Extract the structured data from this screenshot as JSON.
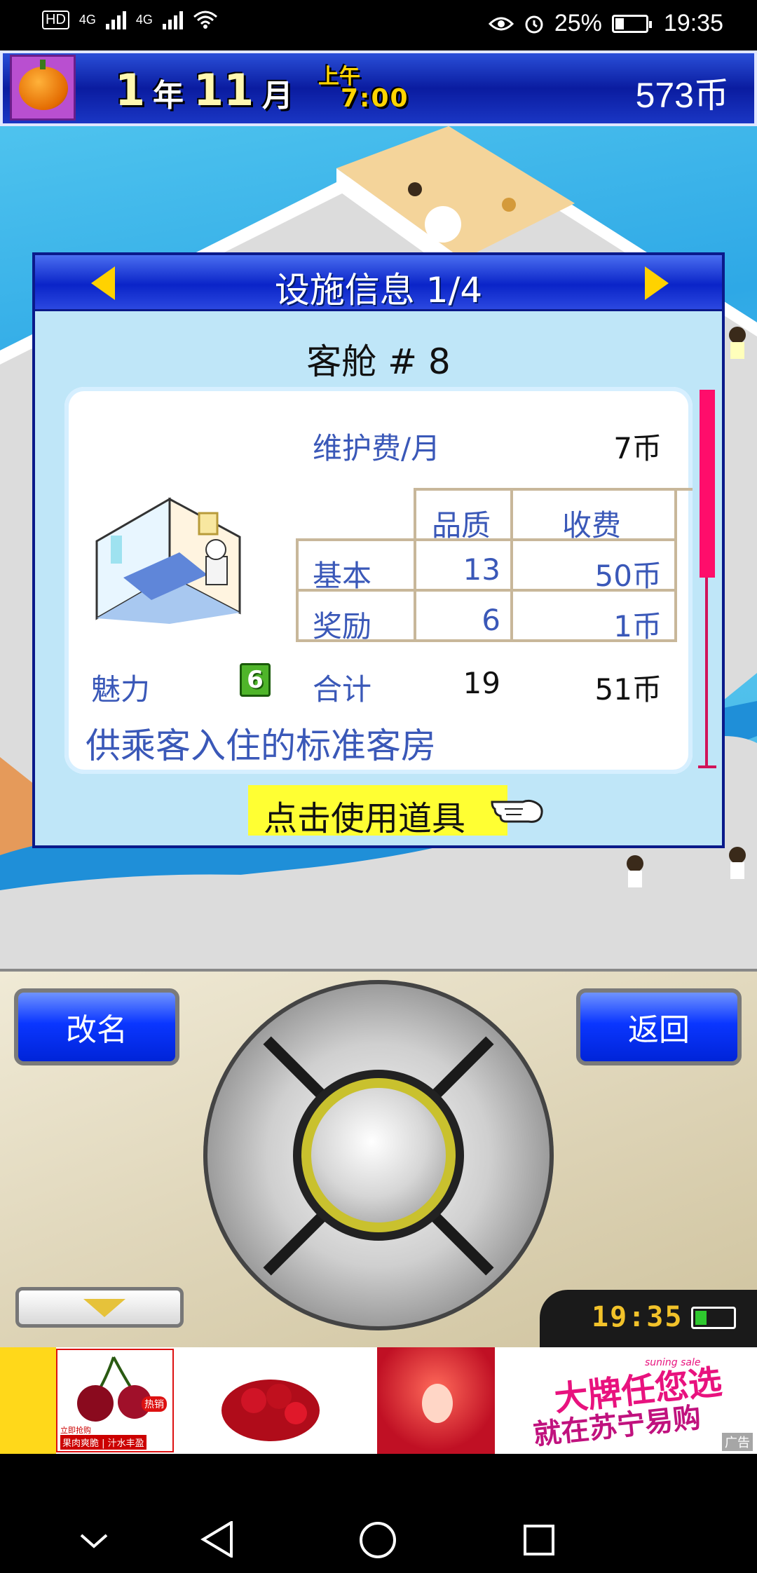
{
  "status_bar": {
    "left_badges": [
      "HD",
      "4G",
      "4G"
    ],
    "battery": "25%",
    "time": "19:35"
  },
  "header": {
    "year_num": "1",
    "year_unit": "年",
    "month_num": "11",
    "month_unit": "月",
    "period": "上午",
    "clock": "7:00",
    "coins": "573币"
  },
  "dialog": {
    "title": "设施信息 1/4",
    "facility_name": "客舱 # 8",
    "maintenance_label": "维护费/月",
    "maintenance_value": "7币",
    "table": {
      "headers": [
        "品质",
        "收费"
      ],
      "rows": [
        {
          "label": "基本",
          "quality": "13",
          "fee": "50币"
        },
        {
          "label": "奖励",
          "quality": "6",
          "fee": "1币"
        }
      ],
      "total": {
        "label": "合计",
        "quality": "19",
        "fee": "51币"
      }
    },
    "charm_label": "魅力",
    "charm_value": "6",
    "description": "供乘客入住的标准客房",
    "use_item_label": "点击使用道具"
  },
  "controls": {
    "rename_label": "改名",
    "back_label": "返回",
    "clock": "19:35"
  },
  "ad": {
    "headline_top": "大牌任您选",
    "headline_bottom": "就在苏宁易购",
    "sale_tag": "suning sale",
    "ad_label": "广告",
    "thumb_labels": [
      "热销",
      "果肉爽脆 | 汁水丰盈",
      "立即抢购"
    ]
  },
  "colors": {
    "header_blue": "#0a1ca0",
    "dialog_bg": "#bfe6f8",
    "button_blue": "#0a36ff",
    "highlight_yellow": "#ffff33",
    "scrollbar_pink": "#ff0d6b",
    "stat_text_blue": "#3a58b8"
  },
  "icons": [
    "pumpkin-icon",
    "eye-icon",
    "alarm-icon",
    "battery-icon",
    "wifi-icon",
    "signal-icon",
    "left-arrow-icon",
    "right-arrow-icon",
    "bed-room-icon",
    "pointing-hand-icon",
    "down-triangle-icon",
    "back-nav-icon",
    "home-nav-icon",
    "recents-nav-icon"
  ]
}
